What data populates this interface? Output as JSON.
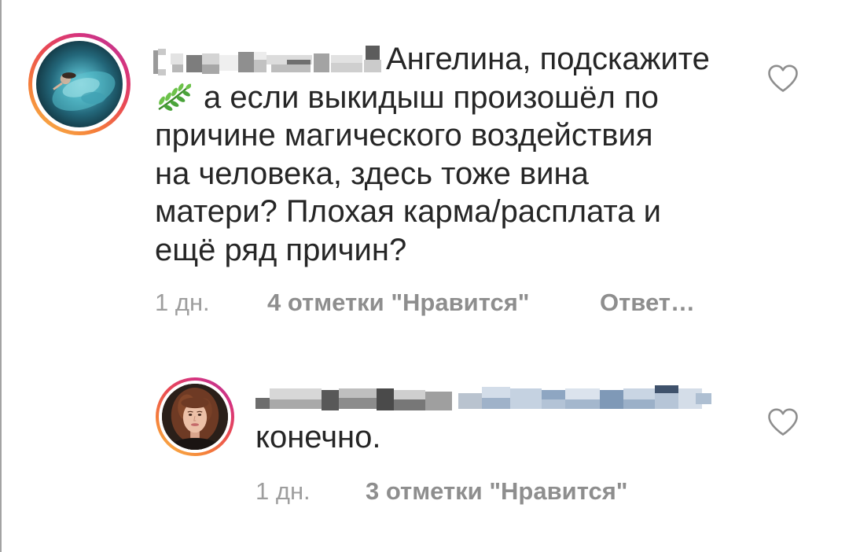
{
  "comments": [
    {
      "lines": [
        "Ангелина, подскажите",
        "а если выкидыш произошёл по",
        "причине магического воздействия",
        "на человека, здесь тоже вина",
        "матери? Плохая карма/расплата и",
        "ещё ряд причин?"
      ],
      "emoji_icon": "herb-icon",
      "time": "1 дн.",
      "likes": "4 отметки \"Нравится\"",
      "reply": "Ответ…",
      "like_icon": "heart-outline-icon"
    },
    {
      "lines": [
        "конечно."
      ],
      "time": "1 дн.",
      "likes": "3 отметки \"Нравится\"",
      "like_icon": "heart-outline-icon"
    }
  ],
  "colors": {
    "text": "#262626",
    "time": "#9e9e9e",
    "meta": "#8e8e8e",
    "heart": "#8e8e8e"
  }
}
